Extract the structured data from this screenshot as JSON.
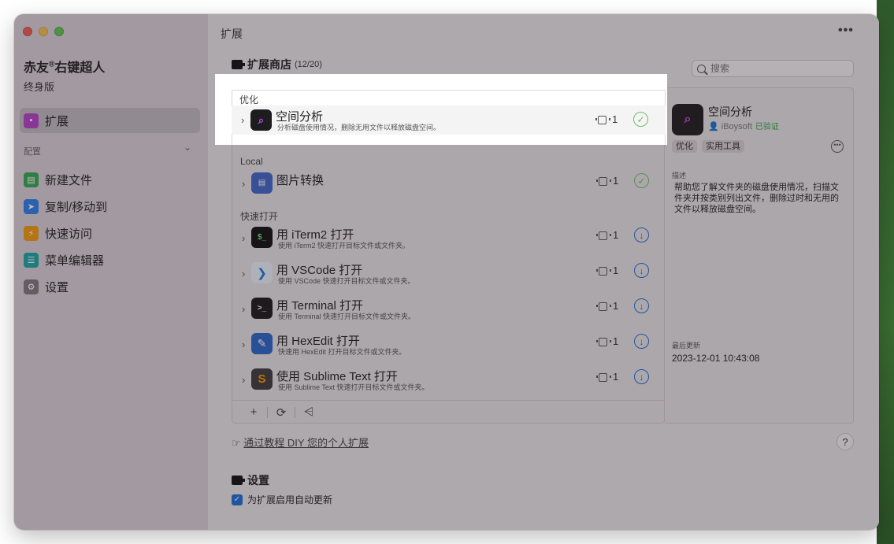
{
  "app": {
    "title": "赤友",
    "title_reg": "®",
    "title_rest": "右键超人",
    "edition": "终身版"
  },
  "sidebar": {
    "top_item": {
      "label": "扩展",
      "icon": "extension-icon",
      "color": "#b542c9"
    },
    "section_label": "配置",
    "items": [
      {
        "label": "新建文件",
        "icon": "new-file-icon",
        "color": "#34a853"
      },
      {
        "label": "复制/移动到",
        "icon": "send-icon",
        "color": "#2f80ed"
      },
      {
        "label": "快速访问",
        "icon": "bolt-icon",
        "color": "#f39c12"
      },
      {
        "label": "菜单编辑器",
        "icon": "list-icon",
        "color": "#1aa6a6"
      },
      {
        "label": "设置",
        "icon": "gear-icon",
        "color": "#7a7a7a"
      }
    ]
  },
  "header": {
    "title": "扩展",
    "more": "•••"
  },
  "store": {
    "title": "扩展商店",
    "count": "(12/20)"
  },
  "search": {
    "placeholder": "搜索"
  },
  "groups": [
    {
      "label": "优化",
      "items": [
        {
          "name": "空间分析",
          "desc": "分析磁盘使用情况，删除无用文件以释放磁盘空间。",
          "version": "1",
          "state": "installed",
          "icon_color": "#1d1d1f",
          "icon_glyph": "⌕"
        }
      ]
    },
    {
      "label": "Local",
      "items": [
        {
          "name": "图片转换",
          "desc": "",
          "version": "1",
          "state": "installed",
          "icon_color": "#3f67c7",
          "icon_glyph": "▤"
        }
      ]
    },
    {
      "label": "快速打开",
      "items": [
        {
          "name": "用 iTerm2 打开",
          "desc": "使用 iTerm2 快速打开目标文件或文件夹。",
          "version": "1",
          "state": "download",
          "icon_color": "#111111",
          "icon_glyph": "$_"
        },
        {
          "name": "用 VSCode 打开",
          "desc": "使用 VSCode 快速打开目标文件或文件夹。",
          "version": "1",
          "state": "download",
          "icon_color": "#eaf2fb",
          "icon_glyph": "❯"
        },
        {
          "name": "用 Terminal 打开",
          "desc": "使用 Terminal 快速打开目标文件或文件夹。",
          "version": "1",
          "state": "download",
          "icon_color": "#1b1b1b",
          "icon_glyph": ">_"
        },
        {
          "name": "用 HexEdit 打开",
          "desc": "快速用 HexEdit 打开目标文件或文件夹。",
          "version": "1",
          "state": "download",
          "icon_color": "#2a66c8",
          "icon_glyph": "✎"
        },
        {
          "name": "使用 Sublime Text 打开",
          "desc": "使用 Sublime Text 快速打开目标文件或文件夹。",
          "version": "1",
          "state": "download",
          "icon_color": "#3d3d3d",
          "icon_glyph": "S"
        }
      ]
    }
  ],
  "toolbar": {
    "add": "+",
    "refresh": "⟳",
    "filter": "⩤"
  },
  "detail": {
    "name": "空间分析",
    "author": "iBoysoft",
    "verified": "已验证",
    "tags": [
      "优化",
      "实用工具"
    ],
    "menu": "•••",
    "desc_label": "描述",
    "desc": "帮助您了解文件夹的磁盘使用情况，扫描文件夹并按类别列出文件，删除过时和无用的文件以释放磁盘空间。",
    "updated_label": "最后更新",
    "updated": "2023-12-01 10:43:08"
  },
  "diy_link": "通过教程 DIY 您的个人扩展",
  "help": "?",
  "settings": {
    "title": "设置",
    "auto_update_label": "为扩展启用自动更新",
    "auto_update": true
  }
}
